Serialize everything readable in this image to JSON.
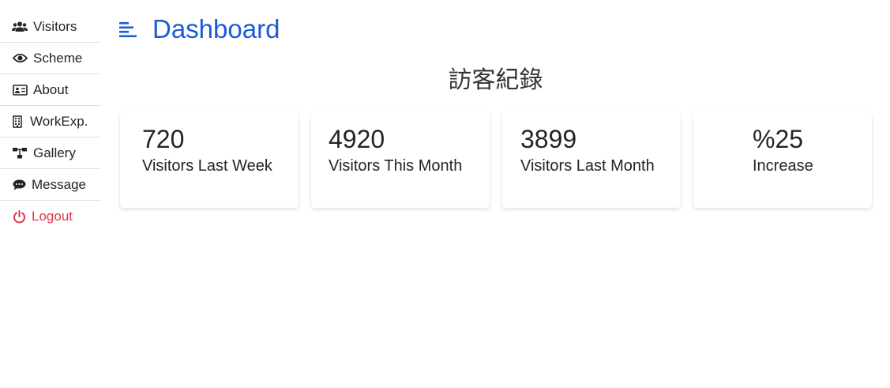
{
  "sidebar": {
    "items": [
      {
        "label": "Visitors",
        "icon": "users-icon"
      },
      {
        "label": "Scheme",
        "icon": "eye-icon"
      },
      {
        "label": "About",
        "icon": "id-card-icon"
      },
      {
        "label": "WorkExp.",
        "icon": "building-icon"
      },
      {
        "label": "Gallery",
        "icon": "sitemap-icon"
      },
      {
        "label": "Message",
        "icon": "comment-icon"
      },
      {
        "label": "Logout",
        "icon": "power-icon",
        "color": "#dc3545"
      }
    ]
  },
  "header": {
    "title": "Dashboard",
    "title_color": "#1a5bd6",
    "menu_icon": "align-left-icon"
  },
  "main": {
    "subtitle": "訪客紀錄",
    "cards": [
      {
        "value": "720",
        "label": "Visitors Last Week"
      },
      {
        "value": "4920",
        "label": "Visitors This Month"
      },
      {
        "value": "3899",
        "label": "Visitors Last Month"
      },
      {
        "value": "%25",
        "label": "Increase"
      }
    ]
  }
}
